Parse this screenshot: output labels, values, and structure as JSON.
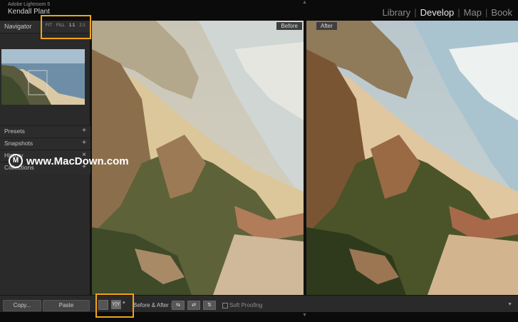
{
  "identity": {
    "app_name": "Adobe Lightroom 5",
    "user_name": "Kendall Plant"
  },
  "modules": [
    {
      "label": "Library",
      "active": false
    },
    {
      "label": "Develop",
      "active": true
    },
    {
      "label": "Map",
      "active": false
    },
    {
      "label": "Book",
      "active": false
    }
  ],
  "navigator": {
    "title": "Navigator",
    "zoom_options": [
      "FIT",
      "FILL",
      "1:1",
      "2:1"
    ],
    "selected_zoom": "1:1"
  },
  "left_sections": [
    {
      "label": "Presets",
      "icon": "plus-icon"
    },
    {
      "label": "Snapshots",
      "icon": "plus-icon"
    },
    {
      "label": "History",
      "icon": "close-icon"
    },
    {
      "label": "Collections",
      "icon": "plus-icon"
    }
  ],
  "views": {
    "before_label": "Before",
    "after_label": "After"
  },
  "toolbar": {
    "copy_label": "Copy...",
    "paste_label": "Paste",
    "view_mode_icon": "Y|Y",
    "before_after_label": "Before & After :",
    "soft_proofing_label": "Soft Proofing"
  },
  "watermark": {
    "text": "www.MacDown.com",
    "logo": "M"
  },
  "colors": {
    "highlight": "#f2a319",
    "panel_bg": "#2a2a2a",
    "top_bg": "#0b0b0b"
  }
}
